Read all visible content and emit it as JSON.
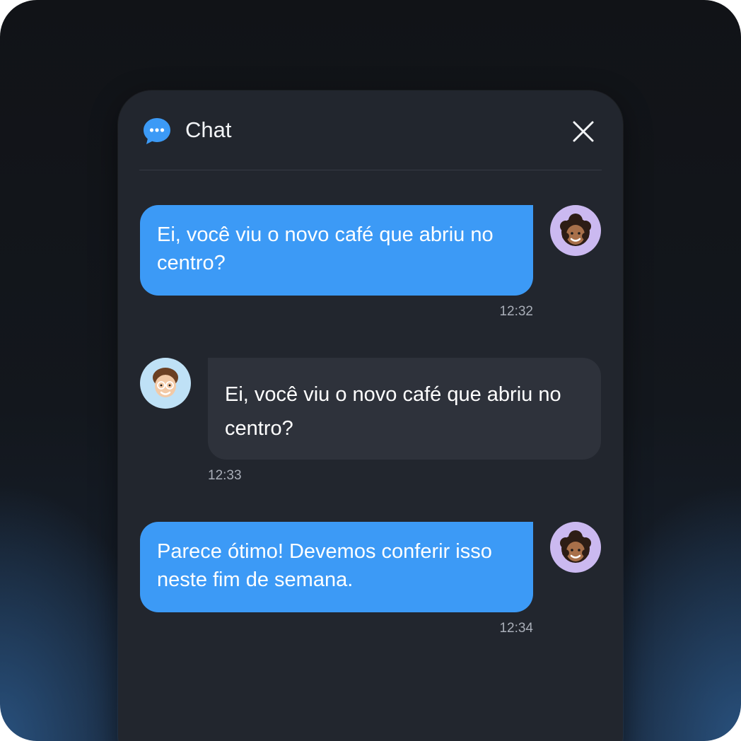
{
  "header": {
    "title": "Chat",
    "chat_icon": "chat-bubble-icon",
    "close_icon": "close-icon",
    "accent_color": "#3c9af6"
  },
  "messages": [
    {
      "direction": "outgoing",
      "text": "Ei, você viu o novo café que abriu no centro?",
      "time": "12:32",
      "avatar": "avatar-curly-hair"
    },
    {
      "direction": "incoming",
      "text": "Ei, você viu o novo café que abriu no centro?",
      "time": "12:33",
      "avatar": "avatar-glasses"
    },
    {
      "direction": "outgoing",
      "text": "Parece ótimo! Devemos conferir isso neste fim de semana.",
      "time": "12:34",
      "avatar": "avatar-curly-hair"
    }
  ]
}
